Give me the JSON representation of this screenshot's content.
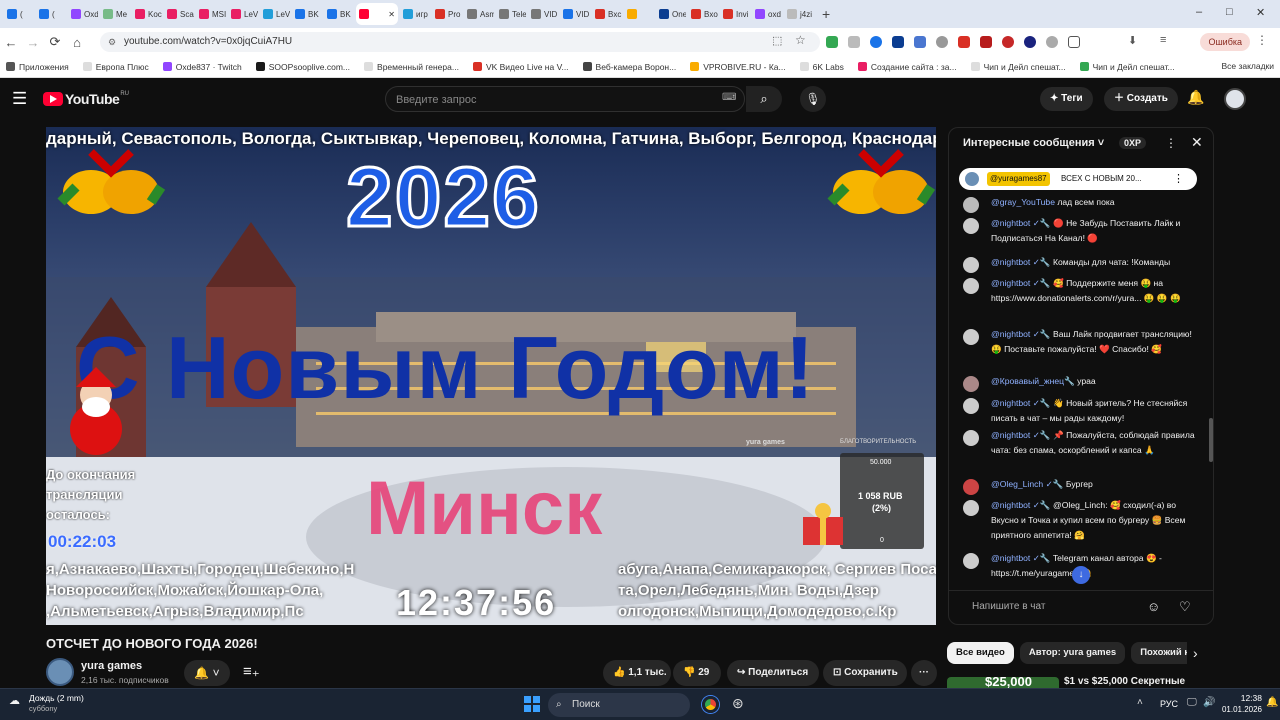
{
  "browser": {
    "tabs": [
      {
        "label": "(",
        "color": "#1a73e8"
      },
      {
        "label": "(",
        "color": "#1a73e8"
      },
      {
        "label": "Oxd",
        "color": "#9146ff"
      },
      {
        "label": "Me",
        "color": "#7b8",
        "color2": ""
      },
      {
        "label": "Koc",
        "color": "#e91e63"
      },
      {
        "label": "Scan",
        "color": "#e91e63"
      },
      {
        "label": "MSI",
        "color": "#e91e63"
      },
      {
        "label": "LeVi",
        "color": "#e91e63"
      },
      {
        "label": "LeVi",
        "color": "#229ed9"
      },
      {
        "label": "BK",
        "color": "#1a73e8"
      },
      {
        "label": "BK",
        "color": "#1a73e8"
      },
      {
        "label": "",
        "color": "#ff0033",
        "active": true
      },
      {
        "label": "игр",
        "color": "#229ed9"
      },
      {
        "label": "Pro",
        "color": "#d93025"
      },
      {
        "label": "Asm",
        "color": "#777"
      },
      {
        "label": "Tele",
        "color": "#777"
      },
      {
        "label": "VIDI",
        "color": "#777"
      },
      {
        "label": "VIDI",
        "color": "#1a73e8"
      },
      {
        "label": "Bxc",
        "color": "#d93025"
      },
      {
        "label": "",
        "color": "#f9ab00"
      },
      {
        "label": "One",
        "color": "#0b3d91"
      },
      {
        "label": "Bxo",
        "color": "#d93025"
      },
      {
        "label": "Invi",
        "color": "#d93025"
      },
      {
        "label": "oxd",
        "color": "#9146ff"
      },
      {
        "label": "j4zi",
        "color": "#bbb"
      }
    ],
    "new_tab": "+",
    "url": "youtube.com/watch?v=0x0jqCuiA7HU",
    "error_label": "Ошибка",
    "bookmarks": [
      {
        "label": "Приложения",
        "color": "#555"
      },
      {
        "label": "Европа Плюс",
        "color": "#ddd"
      },
      {
        "label": "Oxde837 · Twitch",
        "color": "#9146ff"
      },
      {
        "label": "SOOPsooplive.com...",
        "color": "#1a1a1a"
      },
      {
        "label": "Временный генера...",
        "color": "#ddd"
      },
      {
        "label": "VK Видео Live на V...",
        "color": "#d93025"
      },
      {
        "label": "Веб-камера Ворон...",
        "color": "#444"
      },
      {
        "label": "VPROBIVE.RU - Ка...",
        "color": "#f9ab00"
      },
      {
        "label": "6K Labs",
        "color": "#ddd"
      },
      {
        "label": "Создание сайта : за...",
        "color": "#e91e63"
      },
      {
        "label": "Чип и Дейл спешат...",
        "color": "#ddd"
      },
      {
        "label": "Чип и Дейл спешат...",
        "color": "#34a853"
      }
    ],
    "all_bookmarks": "Все закладки"
  },
  "youtube": {
    "logo": "YouTube",
    "logo_region": "RU",
    "search_placeholder": "Введите запрос",
    "tags_label": "Теги",
    "create_label": "Создать"
  },
  "video": {
    "top_ticker": "дарный, Севастополь, Вологда, Сыктывкар, Череповец, Коломна, Гатчина, Выборг, Белгород, Краснодар, С",
    "year": "2026",
    "greeting": "С Новым Годом!",
    "city": "Минск",
    "countdown_label_1": "До окончания",
    "countdown_label_2": "трансляции",
    "countdown_label_3": "осталось:",
    "countdown": "00:22:03",
    "clock": "12:37:56",
    "watermark": "yura games",
    "donation_title": "БЛАГОТВОРИТЕЛЬНОСТЬ",
    "donation_goal": "50.000",
    "donation_amount": "1 058 RUB",
    "donation_percent": "(2%)",
    "donation_zero": "0",
    "ticker_rows": [
      "я,Азнакаево,Шахты,Городец,Шебекино,Н",
      "Новороссийск,Можайск,Йошкар-Ола,",
      ",Альметьевск,Агрыз,Владимир,Пс"
    ],
    "ticker_rows_right": [
      "абуга,Анапа,Семикаракорск, Сергиев Поса",
      "та,Орел,Лебедянь,Мин. Воды,Дзер",
      "олгодонск,Мытищи,Домодедово,с.Кр"
    ]
  },
  "title": "ОТСЧЕТ ДО НОВОГО ГОДА 2026!",
  "channel": {
    "name": "yura games",
    "subscribers": "2,16 тыс. подписчиков"
  },
  "actions": {
    "likes": "1,1 тыс.",
    "dislikes": "29",
    "share": "Поделиться",
    "save": "Сохранить"
  },
  "chat": {
    "header": "Интересные сообщения",
    "points": "0XP",
    "pinned_author": "@yuragames87",
    "pinned_text": "ВСЕХ С НОВЫМ 20...",
    "input_placeholder": "Напишите в чат",
    "messages": [
      {
        "author": "@gray_YouTube",
        "text": "лад всем пока",
        "avatar": "#bbb"
      },
      {
        "author": "@nightbot ✓🔧",
        "text": "🔴 Не Забудь Поставить Лайк и Подписаться На Канал! 🔴",
        "avatar": "#ccc"
      },
      {
        "author": "@nightbot ✓🔧",
        "text": "Команды для чата: !Команды",
        "avatar": "#ccc"
      },
      {
        "author": "@nightbot ✓🔧",
        "text": "🥰 Поддержите меня 🤑 на https://www.donationalerts.com/r/yura... 🤑 🤑 🤑",
        "avatar": "#ccc"
      },
      {
        "author": "@nightbot ✓🔧",
        "text": "Ваш Лайк продвигает трансляцию! 🤑 Поставьте пожалуйста! ❤️ Спасибо! 🥰",
        "avatar": "#ccc"
      },
      {
        "author": "@Кровавый_жнец🔧",
        "text": "ураа",
        "avatar": "#a88"
      },
      {
        "author": "@nightbot ✓🔧",
        "text": "👋 Новый зритель? Не стесняйся писать в чат – мы рады каждому!",
        "avatar": "#ccc"
      },
      {
        "author": "@nightbot ✓🔧",
        "text": "📌 Пожалуйста, соблюдай правила чата: без спама, оскорблений и капса 🙏",
        "avatar": "#ccc"
      },
      {
        "author": "@Oleg_Linch ✓🔧",
        "text": "Бургер",
        "avatar": "#c44"
      },
      {
        "author": "@nightbot ✓🔧",
        "text": "@Oleg_Linch: 🥰 сходил(-а) во Вкусно и Точка и купил всем по бургеру 🍔 Всем приятного аппетита! 🤗",
        "avatar": "#ccc"
      },
      {
        "author": "@nightbot ✓🔧",
        "text": "Telegram канал автора 😍 - https://t.me/yuragames 🤗",
        "avatar": "#ccc"
      }
    ]
  },
  "chips": [
    "Все видео",
    "Автор: yura games",
    "Похожий кон"
  ],
  "recommendation": {
    "thumb_text": "$25,000",
    "title": "$1 vs $25,000 Секретные"
  },
  "taskbar": {
    "weather": "Дождь (2 mm)",
    "weather_sub": "суббоnу",
    "search": "Поиск",
    "lang": "РУС",
    "time": "12:38",
    "date": "01.01.2026"
  }
}
